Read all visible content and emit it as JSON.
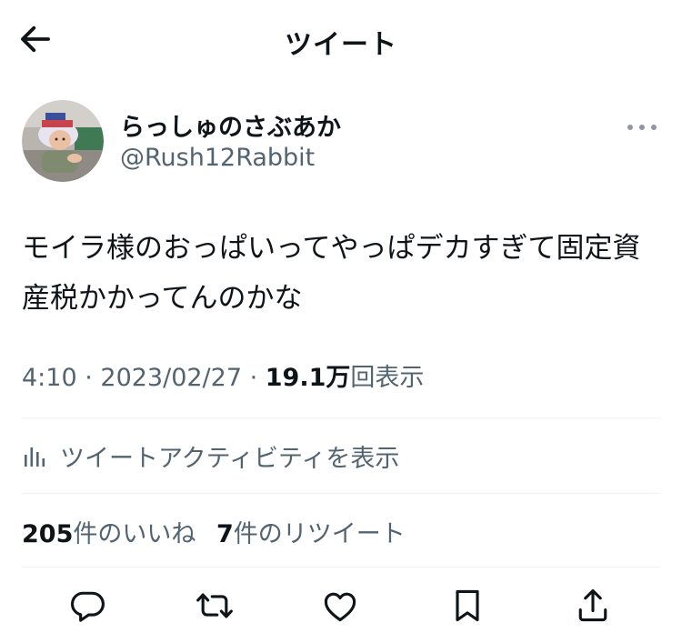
{
  "header": {
    "title": "ツイート",
    "back_icon": "arrow-left-icon"
  },
  "author": {
    "display_name": "らっしゅのさぶあか",
    "handle": "@Rush12Rabbit",
    "more_icon": "more-horizontal-icon"
  },
  "tweet": {
    "text": "モイラ様のおっぱいってやっぱデカすぎて固定資\n産税かかってんのかな"
  },
  "meta": {
    "time": "4:10",
    "separator": " · ",
    "date": "2023/02/27",
    "views_count": "19.1万",
    "views_label": "回表示"
  },
  "activity": {
    "label": "ツイートアクティビティを表示",
    "icon": "analytics-icon"
  },
  "stats": {
    "likes_count": "205",
    "likes_label": "件のいいね",
    "retweets_count": "7",
    "retweets_label": "件のリツイート"
  },
  "actions": {
    "reply_icon": "reply-icon",
    "retweet_icon": "retweet-icon",
    "like_icon": "heart-icon",
    "bookmark_icon": "bookmark-icon",
    "share_icon": "share-icon"
  },
  "colors": {
    "text_primary": "#0f1419",
    "text_secondary": "#536471",
    "divider": "#eff3f4"
  }
}
